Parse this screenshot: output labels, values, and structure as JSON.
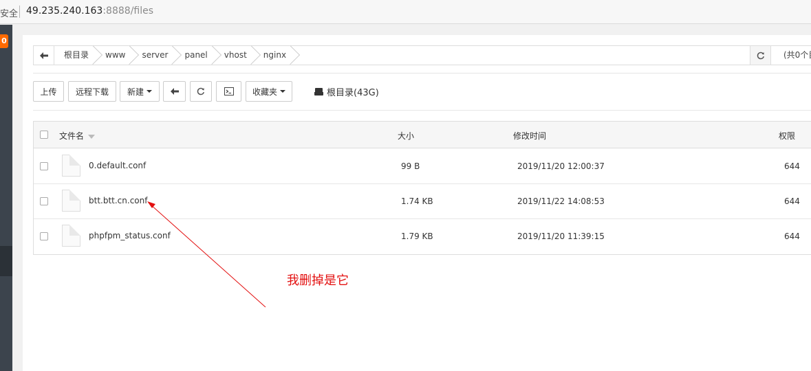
{
  "browser": {
    "secure_label": "安全",
    "url_host": "49.235.240.163",
    "url_port_path": ":8888/files"
  },
  "sidebar": {
    "badge": "0"
  },
  "breadcrumb": {
    "items": [
      "根目录",
      "www",
      "server",
      "panel",
      "vhost",
      "nginx"
    ],
    "count_text": "(共0个目"
  },
  "toolbar": {
    "upload": "上传",
    "remote_download": "远程下载",
    "new": "新建",
    "favorites": "收藏夹",
    "disk_label": "根目录(43G)"
  },
  "table": {
    "headers": {
      "name": "文件名",
      "size": "大小",
      "mtime": "修改时间",
      "perm": "权限"
    },
    "rows": [
      {
        "name": "0.default.conf",
        "size": "99 B",
        "mtime": "2019/11/20 12:00:37",
        "perm": "644"
      },
      {
        "name": "btt.btt.cn.conf",
        "size": "1.74 KB",
        "mtime": "2019/11/22 14:08:53",
        "perm": "644"
      },
      {
        "name": "phpfpm_status.conf",
        "size": "1.79 KB",
        "mtime": "2019/11/20 11:39:15",
        "perm": "644"
      }
    ]
  },
  "annotation": {
    "text": "我删掉是它",
    "color": "#e31010"
  },
  "icons": {
    "back": "arrow-left-icon",
    "refresh": "refresh-icon",
    "terminal": "terminal-icon",
    "disk": "hdd-icon",
    "file": "file-icon"
  }
}
